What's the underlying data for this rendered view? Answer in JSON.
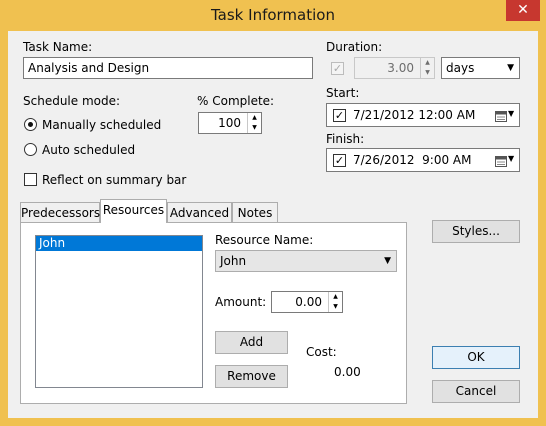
{
  "window": {
    "title": "Task Information",
    "close_glyph": "✕"
  },
  "task": {
    "name_label": "Task Name:",
    "name_value": "Analysis and Design"
  },
  "duration": {
    "label": "Duration:",
    "value": "3.00",
    "unit": "days",
    "checked": true
  },
  "schedule": {
    "label": "Schedule mode:",
    "manual_label": "Manually scheduled",
    "auto_label": "Auto scheduled",
    "selected": "manual"
  },
  "percent": {
    "label": "% Complete:",
    "value": "100"
  },
  "start": {
    "label": "Start:",
    "value": "7/21/2012 12:00 AM",
    "checked": true
  },
  "finish": {
    "label": "Finish:",
    "value": "7/26/2012  9:00 AM",
    "checked": true
  },
  "reflect": {
    "label": "Reflect on summary bar",
    "checked": false
  },
  "tabs": [
    {
      "label": "Predecessors"
    },
    {
      "label": "Resources"
    },
    {
      "label": "Advanced"
    },
    {
      "label": "Notes"
    }
  ],
  "active_tab": "Resources",
  "resources": {
    "list": [
      "John"
    ],
    "selected": "John",
    "name_label": "Resource Name:",
    "name_value": "John",
    "amount_label": "Amount:",
    "amount_value": "0.00",
    "add_label": "Add",
    "remove_label": "Remove",
    "cost_label": "Cost:",
    "cost_value": "0.00"
  },
  "buttons": {
    "styles": "Styles...",
    "ok": "OK",
    "cancel": "Cancel"
  },
  "icons": {
    "checkmark": "✓",
    "calendar": "calendar-icon",
    "dropdown": "▼"
  },
  "colors": {
    "titlebar": "#f0c150",
    "close": "#c7372f",
    "selection": "#0078d7",
    "default_button": "#3c7fb1"
  }
}
